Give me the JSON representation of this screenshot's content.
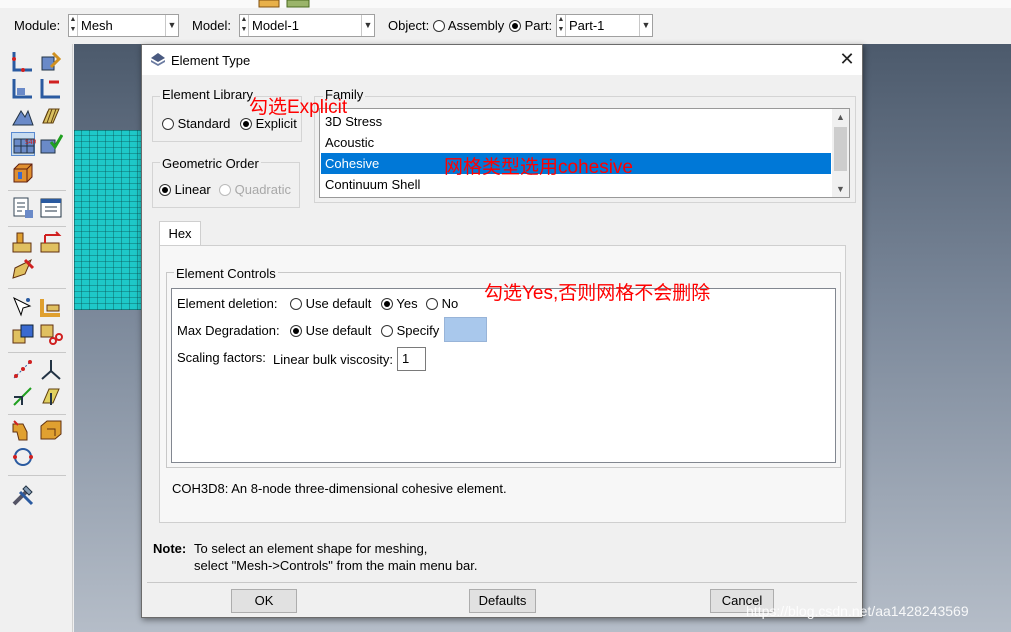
{
  "context_bar": {
    "module_label": "Module:",
    "module_value": "Mesh",
    "model_label": "Model:",
    "model_value": "Model-1",
    "object_label": "Object:",
    "assembly_label": "Assembly",
    "part_label": "Part:",
    "part_value": "Part-1"
  },
  "dialog": {
    "title": "Element Type",
    "close_glyph": "✕",
    "element_library": {
      "label": "Element Library",
      "options": [
        "Standard",
        "Explicit"
      ],
      "selected": "Explicit"
    },
    "geometric_order": {
      "label": "Geometric Order",
      "options": [
        "Linear",
        "Quadratic"
      ],
      "selected": "Linear"
    },
    "family": {
      "label": "Family",
      "items": [
        "3D Stress",
        "Acoustic",
        "Cohesive",
        "Continuum Shell"
      ],
      "selected": "Cohesive"
    },
    "tab": "Hex",
    "element_controls": {
      "label": "Element Controls",
      "element_deletion_label": "Element deletion:",
      "element_deletion_options": [
        "Use default",
        "Yes",
        "No"
      ],
      "element_deletion_selected": "Yes",
      "max_degradation_label": "Max Degradation:",
      "max_degradation_options": [
        "Use default",
        "Specify"
      ],
      "max_degradation_selected": "Use default",
      "scaling_label": "Scaling factors:",
      "bulk_viscosity_label": "Linear bulk viscosity:",
      "bulk_viscosity_value": "1"
    },
    "description": "COH3D8:  An 8-node three-dimensional cohesive element.",
    "note_label": "Note:",
    "note_line1": "To select an element shape for meshing,",
    "note_line2": "select \"Mesh->Controls\" from the main menu bar.",
    "buttons": {
      "ok": "OK",
      "defaults": "Defaults",
      "cancel": "Cancel"
    }
  },
  "annotations": {
    "explicit": "勾选Explicit",
    "cohesive": "网格类型选用cohesive",
    "yes": "勾选Yes,否则网格不会删除"
  },
  "watermark": "https://blog.csdn.net/aa1428243569",
  "colors": {
    "selection": "#0078d7",
    "annotation": "#ff0000",
    "mesh": "#1ec8c8",
    "specify_box": "#a9c8ec"
  }
}
